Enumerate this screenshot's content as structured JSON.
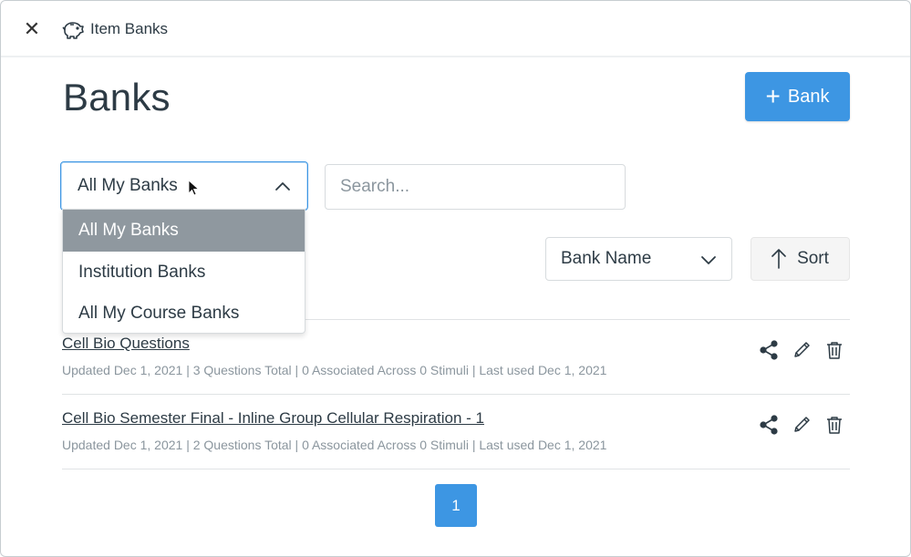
{
  "titlebar": {
    "close_glyph": "✕",
    "app_icon": "piggy-bank-icon",
    "title": "Item Banks"
  },
  "page": {
    "title": "Banks",
    "add_button_label": "Bank",
    "add_button_icon": "plus-icon"
  },
  "filter": {
    "selected": "All My Banks",
    "options": [
      {
        "label": "All My Banks",
        "selected": true
      },
      {
        "label": "Institution Banks",
        "selected": false
      },
      {
        "label": "All My Course Banks",
        "selected": false
      }
    ]
  },
  "search": {
    "placeholder": "Search..."
  },
  "sort": {
    "field": "Bank Name",
    "button_label": "Sort",
    "direction_icon": "arrow-up-icon"
  },
  "banks": [
    {
      "name": "Cell Bio Questions",
      "meta": "Updated Dec 1, 2021 | 3 Questions Total | 0 Associated Across 0 Stimuli | Last used Dec 1, 2021"
    },
    {
      "name": "Cell Bio Semester Final - Inline Group Cellular Respiration - 1",
      "meta": "Updated Dec 1, 2021 | 2 Questions Total | 0 Associated Across 0 Stimuli | Last used Dec 1, 2021"
    }
  ],
  "pagination": {
    "current": "1"
  },
  "colors": {
    "primary": "#3d96e3",
    "selected_option": "#8f989f",
    "text": "#2d3b45",
    "muted": "#8b969e"
  }
}
